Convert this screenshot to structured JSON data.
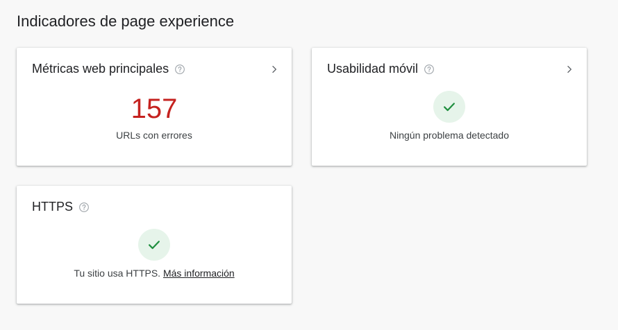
{
  "page": {
    "title": "Indicadores de page experience"
  },
  "cards": {
    "core_web_vitals": {
      "title": "Métricas web principales",
      "value": "157",
      "caption": "URLs con errores"
    },
    "mobile_usability": {
      "title": "Usabilidad móvil",
      "caption": "Ningún problema detectado"
    },
    "https": {
      "title": "HTTPS",
      "caption_prefix": "Tu sitio usa HTTPS. ",
      "link_label": "Más información"
    }
  },
  "icons": {
    "help": "help-circle-icon",
    "chevron": "chevron-right-icon",
    "check": "check-icon"
  },
  "colors": {
    "error_value": "#c5221f",
    "success_icon": "#1e8e3e",
    "success_bg": "#e6f4ea",
    "muted_icon": "#9aa0a6"
  }
}
